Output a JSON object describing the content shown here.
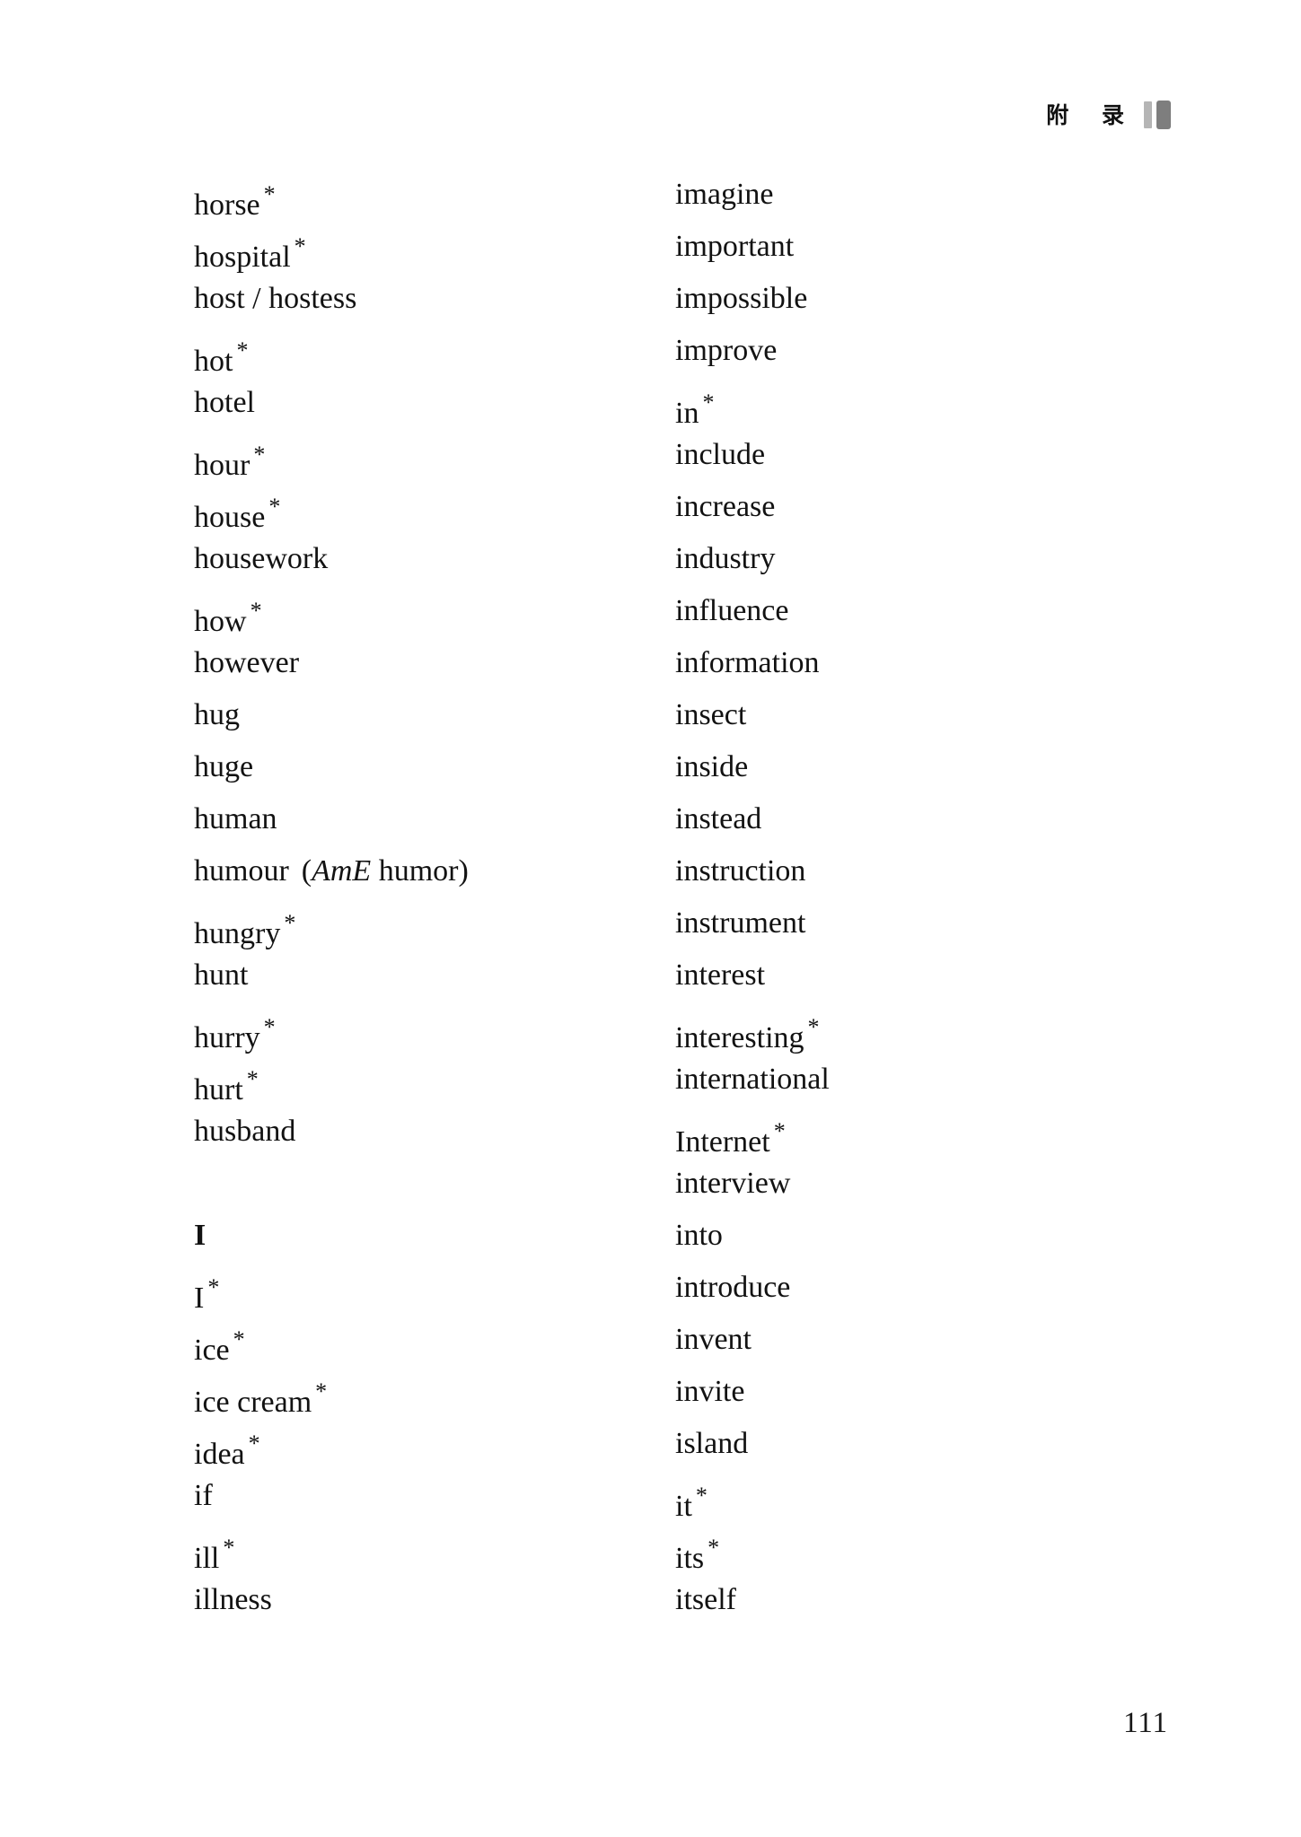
{
  "header": {
    "section_title": "附 录",
    "bar_light_color": "#b5b5b5",
    "bar_dark_color": "#7e7e7e"
  },
  "page_number": "111",
  "columns": {
    "left": [
      {
        "word": "horse",
        "star": "*"
      },
      {
        "word": "hospital",
        "star": "*"
      },
      {
        "word": "host / hostess",
        "star": ""
      },
      {
        "word": "hot",
        "star": "*"
      },
      {
        "word": "hotel",
        "star": ""
      },
      {
        "word": "hour",
        "star": "*"
      },
      {
        "word": "house",
        "star": "*"
      },
      {
        "word": "housework",
        "star": ""
      },
      {
        "word": "how",
        "star": "*"
      },
      {
        "word": "however",
        "star": ""
      },
      {
        "word": "hug",
        "star": ""
      },
      {
        "word": "huge",
        "star": ""
      },
      {
        "word": "human",
        "star": ""
      },
      {
        "word": "humour",
        "star": "",
        "variant_open": "(",
        "variant_tag": "AmE",
        "variant_word": " humor",
        "variant_close": ")"
      },
      {
        "word": "hungry",
        "star": "*"
      },
      {
        "word": "hunt",
        "star": ""
      },
      {
        "word": "hurry",
        "star": "*"
      },
      {
        "word": "hurt",
        "star": "*"
      },
      {
        "word": "husband",
        "star": ""
      },
      {
        "spacer": true
      },
      {
        "word": "I",
        "star": "",
        "heading": true
      },
      {
        "word": "I",
        "star": "*"
      },
      {
        "word": "ice",
        "star": "*"
      },
      {
        "word": "ice cream",
        "star": "*"
      },
      {
        "word": "idea",
        "star": "*"
      },
      {
        "word": "if",
        "star": ""
      },
      {
        "word": "ill",
        "star": "*"
      },
      {
        "word": "illness",
        "star": ""
      }
    ],
    "right": [
      {
        "word": "imagine",
        "star": ""
      },
      {
        "word": "important",
        "star": ""
      },
      {
        "word": "impossible",
        "star": ""
      },
      {
        "word": "improve",
        "star": ""
      },
      {
        "word": "in",
        "star": "*"
      },
      {
        "word": "include",
        "star": ""
      },
      {
        "word": "increase",
        "star": ""
      },
      {
        "word": "industry",
        "star": ""
      },
      {
        "word": "influence",
        "star": ""
      },
      {
        "word": "information",
        "star": ""
      },
      {
        "word": "insect",
        "star": ""
      },
      {
        "word": "inside",
        "star": ""
      },
      {
        "word": "instead",
        "star": ""
      },
      {
        "word": "instruction",
        "star": ""
      },
      {
        "word": "instrument",
        "star": ""
      },
      {
        "word": "interest",
        "star": ""
      },
      {
        "word": "interesting",
        "star": "*"
      },
      {
        "word": "international",
        "star": ""
      },
      {
        "word": "Internet",
        "star": "*"
      },
      {
        "word": "interview",
        "star": ""
      },
      {
        "word": "into",
        "star": ""
      },
      {
        "word": "introduce",
        "star": ""
      },
      {
        "word": "invent",
        "star": ""
      },
      {
        "word": "invite",
        "star": ""
      },
      {
        "word": "island",
        "star": ""
      },
      {
        "word": "it",
        "star": "*"
      },
      {
        "word": "its",
        "star": "*"
      },
      {
        "word": "itself",
        "star": ""
      }
    ]
  }
}
